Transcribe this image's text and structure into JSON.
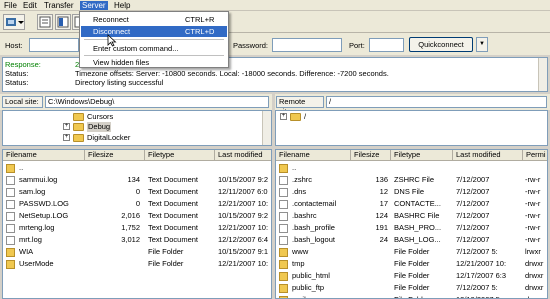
{
  "menubar": {
    "items": [
      "File",
      "Edit",
      "Transfer",
      "Server",
      "Help"
    ]
  },
  "server_menu": {
    "items": [
      {
        "label": "Reconnect",
        "shortcut": "CTRL+R"
      },
      {
        "label": "Disconnect",
        "shortcut": "CTRL+D"
      },
      {
        "label": "Enter custom command...",
        "shortcut": ""
      },
      {
        "label": "View hidden files",
        "shortcut": ""
      }
    ]
  },
  "quickconnect": {
    "host_label": "Host:",
    "password_label": "Password:",
    "port_label": "Port:",
    "button_label": "Quickconnect",
    "dropdown_arrow": "▼"
  },
  "log": [
    {
      "label": "Response:",
      "text": "2",
      "color": "#008000"
    },
    {
      "label": "Status:",
      "text": "Timezone offsets: Server: -10800 seconds. Local: -18000 seconds. Difference: -7200 seconds.",
      "color": "#000000"
    },
    {
      "label": "Status:",
      "text": "Directory listing successful",
      "color": "#000000"
    }
  ],
  "local": {
    "site_label": "Local site:",
    "path": "C:\\Windows\\Debug\\",
    "tree": [
      {
        "name": "Cursors",
        "expander": ""
      },
      {
        "name": "Debug",
        "expander": "+"
      },
      {
        "name": "DigitalLocker",
        "expander": "+"
      }
    ],
    "columns": [
      "Filename",
      "Filesize",
      "Filetype",
      "Last modified"
    ],
    "files": [
      {
        "name": "..",
        "size": "",
        "type": "",
        "modified": "",
        "icon": "up"
      },
      {
        "name": "sammui.log",
        "size": "134",
        "type": "Text Document",
        "modified": "10/15/2007 9:2",
        "icon": "file"
      },
      {
        "name": "sam.log",
        "size": "0",
        "type": "Text Document",
        "modified": "12/11/2007 6:0",
        "icon": "file"
      },
      {
        "name": "PASSWD.LOG",
        "size": "0",
        "type": "Text Document",
        "modified": "12/21/2007 10:",
        "icon": "file"
      },
      {
        "name": "NetSetup.LOG",
        "size": "2,016",
        "type": "Text Document",
        "modified": "10/15/2007 9:2",
        "icon": "file"
      },
      {
        "name": "mrteng.log",
        "size": "1,752",
        "type": "Text Document",
        "modified": "12/21/2007 10:",
        "icon": "file"
      },
      {
        "name": "mrt.log",
        "size": "3,012",
        "type": "Text Document",
        "modified": "12/12/2007 6:4",
        "icon": "file"
      },
      {
        "name": "WIA",
        "size": "",
        "type": "File Folder",
        "modified": "10/15/2007 9:1",
        "icon": "dir"
      },
      {
        "name": "UserMode",
        "size": "",
        "type": "File Folder",
        "modified": "12/21/2007 10:",
        "icon": "dir"
      }
    ]
  },
  "remote": {
    "site_label": "Remote site:",
    "path": "/",
    "tree": [
      {
        "name": "/",
        "expander": "+"
      }
    ],
    "columns": [
      "Filename",
      "Filesize",
      "Filetype",
      "Last modified",
      "Permi"
    ],
    "files": [
      {
        "name": "..",
        "size": "",
        "type": "",
        "modified": "",
        "perm": "",
        "icon": "up"
      },
      {
        "name": ".zshrc",
        "size": "136",
        "type": "ZSHRC File",
        "modified": "7/12/2007",
        "perm": "-rw-r",
        "icon": "file"
      },
      {
        "name": ".dns",
        "size": "12",
        "type": "DNS File",
        "modified": "7/12/2007",
        "perm": "-rw-r",
        "icon": "file"
      },
      {
        "name": ".contactemail",
        "size": "17",
        "type": "CONTACTE...",
        "modified": "7/12/2007",
        "perm": "-rw-r",
        "icon": "file"
      },
      {
        "name": ".bashrc",
        "size": "124",
        "type": "BASHRC File",
        "modified": "7/12/2007",
        "perm": "-rw-r",
        "icon": "file"
      },
      {
        "name": ".bash_profile",
        "size": "191",
        "type": "BASH_PRO...",
        "modified": "7/12/2007",
        "perm": "-rw-r",
        "icon": "file"
      },
      {
        "name": ".bash_logout",
        "size": "24",
        "type": "BASH_LOG...",
        "modified": "7/12/2007",
        "perm": "-rw-r",
        "icon": "file"
      },
      {
        "name": "www",
        "size": "",
        "type": "File Folder",
        "modified": "7/12/2007 5:",
        "perm": "lrwxr",
        "icon": "dir"
      },
      {
        "name": "tmp",
        "size": "",
        "type": "File Folder",
        "modified": "12/21/2007 10:",
        "perm": "drwxr",
        "icon": "dir"
      },
      {
        "name": "public_html",
        "size": "",
        "type": "File Folder",
        "modified": "12/17/2007 6:3",
        "perm": "drwxr",
        "icon": "dir"
      },
      {
        "name": "public_ftp",
        "size": "",
        "type": "File Folder",
        "modified": "7/12/2007 5:",
        "perm": "drwxr",
        "icon": "dir"
      },
      {
        "name": "mail",
        "size": "",
        "type": "File Folder",
        "modified": "12/19/2007 5:",
        "perm": "drwxr",
        "icon": "dir"
      }
    ]
  },
  "colors": {
    "accent": "#316ac5",
    "response_green": "#008000",
    "folder": "#f0c850"
  }
}
